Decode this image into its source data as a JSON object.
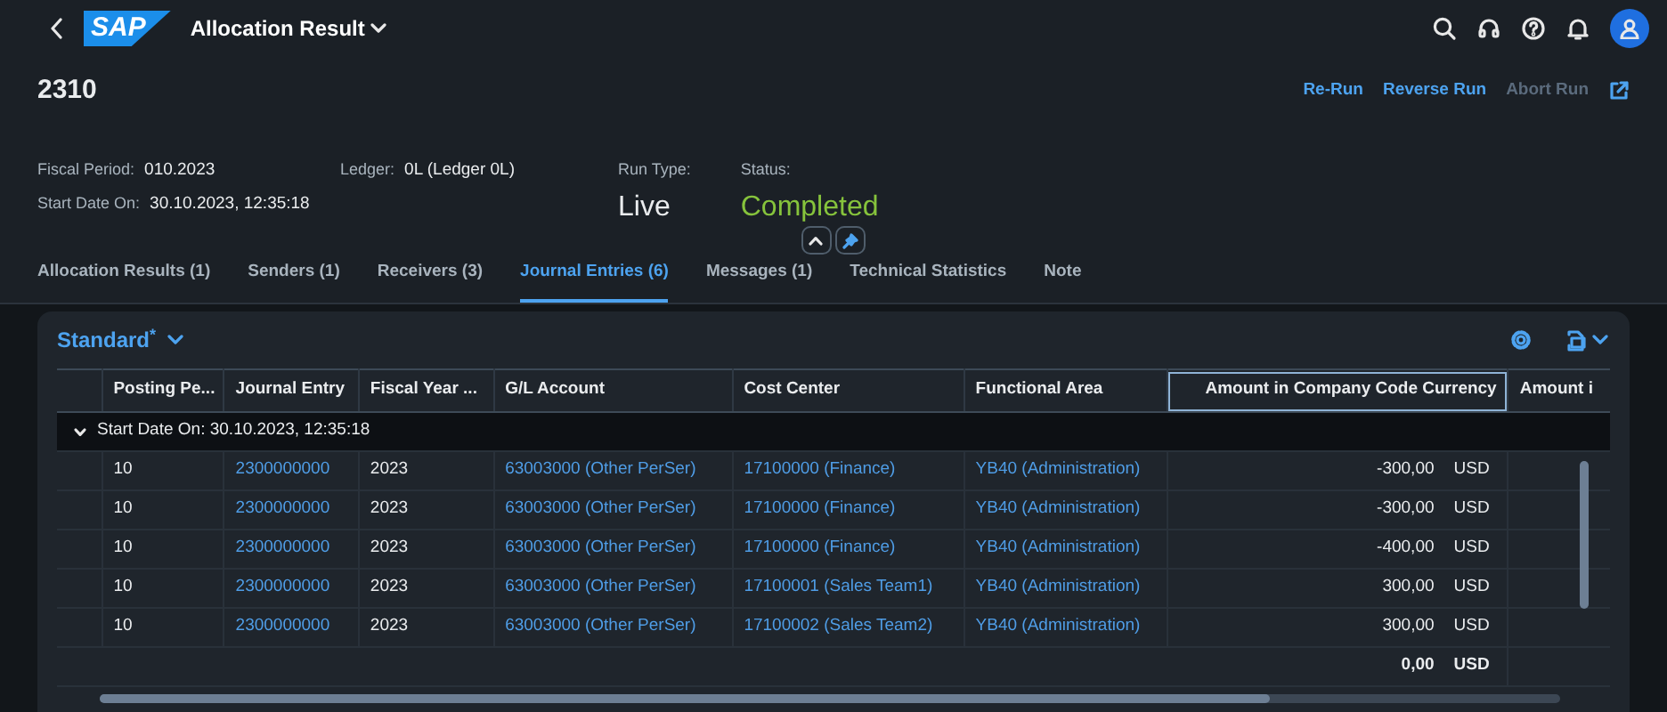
{
  "shell": {
    "logo": "SAP",
    "title": "Allocation Result"
  },
  "header": {
    "title": "2310",
    "actions": [
      {
        "label": "Re-Run",
        "disabled": false
      },
      {
        "label": "Reverse Run",
        "disabled": false
      },
      {
        "label": "Abort Run",
        "disabled": true
      }
    ]
  },
  "attributes": [
    {
      "label": "Fiscal Period:",
      "value": "010.2023"
    },
    {
      "label": "Start Date On:",
      "value": "30.10.2023, 12:35:18"
    },
    {
      "label": "Ledger:",
      "value": "0L (Ledger 0L)"
    }
  ],
  "kpis": [
    {
      "label": "Run Type:",
      "value": "Live",
      "kind": "plain"
    },
    {
      "label": "Status:",
      "value": "Completed",
      "kind": "positive"
    }
  ],
  "tabs": [
    {
      "label": "Allocation Results (1)",
      "selected": false
    },
    {
      "label": "Senders (1)",
      "selected": false
    },
    {
      "label": "Receivers (3)",
      "selected": false
    },
    {
      "label": "Journal Entries (6)",
      "selected": true
    },
    {
      "label": "Messages (1)",
      "selected": false
    },
    {
      "label": "Technical Statistics",
      "selected": false
    },
    {
      "label": "Note",
      "selected": false
    }
  ],
  "variant": {
    "name": "Standard",
    "modified_mark": "*"
  },
  "table": {
    "columns": [
      {
        "label": "Posting Pe...",
        "kind": "text",
        "focused": false
      },
      {
        "label": "Journal Entry",
        "kind": "link",
        "focused": false
      },
      {
        "label": "Fiscal Year ...",
        "kind": "text",
        "focused": false
      },
      {
        "label": "G/L Account",
        "kind": "link",
        "focused": false
      },
      {
        "label": "Cost Center",
        "kind": "link",
        "focused": false
      },
      {
        "label": "Functional Area",
        "kind": "link",
        "focused": false
      },
      {
        "label": "Amount in Company Code Currency",
        "kind": "amount",
        "focused": true
      },
      {
        "label": "Amount i",
        "kind": "text",
        "focused": false
      }
    ],
    "group": {
      "label": "Start Date On: 30.10.2023, 12:35:18",
      "expanded": true
    },
    "rows": [
      {
        "cells": [
          "10",
          "2300000000",
          "2023",
          "63003000 (Other PerSer)",
          "17100000 (Finance)",
          "YB40 (Administration)"
        ],
        "amount": "-300,00",
        "currency": "USD"
      },
      {
        "cells": [
          "10",
          "2300000000",
          "2023",
          "63003000 (Other PerSer)",
          "17100000 (Finance)",
          "YB40 (Administration)"
        ],
        "amount": "-300,00",
        "currency": "USD"
      },
      {
        "cells": [
          "10",
          "2300000000",
          "2023",
          "63003000 (Other PerSer)",
          "17100000 (Finance)",
          "YB40 (Administration)"
        ],
        "amount": "-400,00",
        "currency": "USD"
      },
      {
        "cells": [
          "10",
          "2300000000",
          "2023",
          "63003000 (Other PerSer)",
          "17100001 (Sales Team1)",
          "YB40 (Administration)"
        ],
        "amount": "300,00",
        "currency": "USD"
      },
      {
        "cells": [
          "10",
          "2300000000",
          "2023",
          "63003000 (Other PerSer)",
          "17100002 (Sales Team2)",
          "YB40 (Administration)"
        ],
        "amount": "300,00",
        "currency": "USD"
      }
    ],
    "total": {
      "amount": "0,00",
      "currency": "USD"
    }
  }
}
